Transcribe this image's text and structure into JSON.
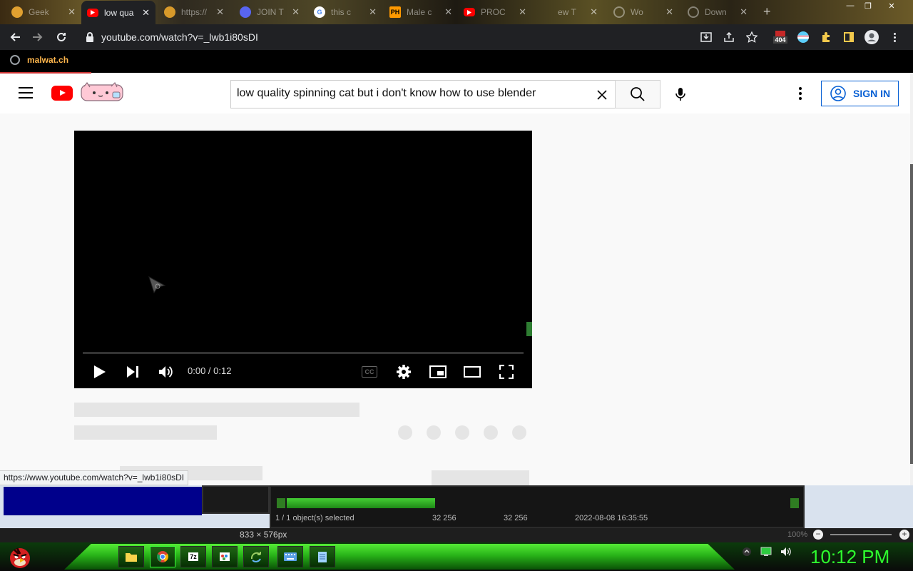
{
  "browser": {
    "tabs": [
      {
        "title": "Geek",
        "favicon": "orange-circle"
      },
      {
        "title": "low qua",
        "favicon": "youtube-icon",
        "active": true
      },
      {
        "title": "https://",
        "favicon": "orange-circle"
      },
      {
        "title": "JOIN T",
        "favicon": "discord-icon"
      },
      {
        "title": "this c",
        "favicon": "google-icon"
      },
      {
        "title": "Male c",
        "favicon": "ph-icon"
      },
      {
        "title": "PROC",
        "favicon": "youtube-icon"
      },
      {
        "title": "ew T",
        "favicon": "none"
      },
      {
        "title": "Wo",
        "favicon": "globe-icon"
      },
      {
        "title": "Down",
        "favicon": "globe-icon"
      }
    ],
    "ph_label": "PH",
    "new_tab_label": "+",
    "url": "youtube.com/watch?v=_lwb1i80sDI",
    "extension_badge": "404",
    "bookmark": "malwat.ch",
    "status_url": "https://www.youtube.com/watch?v=_lwb1i80sDI"
  },
  "youtube": {
    "search_value": "low quality spinning cat but i don't know how to use blender",
    "sign_in": "SIGN IN",
    "player": {
      "time": "0:00 / 0:12",
      "progress": 0,
      "cc_label": "CC"
    }
  },
  "background_app": {
    "selection": "1 / 1 object(s) selected",
    "val1": "32 256",
    "val2": "32 256",
    "timestamp": "2022-08-08 16:35:55",
    "dimensions": "833 × 576px",
    "zoom": "100%"
  },
  "taskbar": {
    "clock": "10:12 PM",
    "zip_label": "7z",
    "apps": [
      "folder-icon",
      "chrome-icon",
      "7zip-icon",
      "paint-icon",
      "recycle-icon",
      "keyboard-icon",
      "notepad-icon"
    ]
  },
  "colors": {
    "youtube_red": "#ff0000",
    "signin_blue": "#065fd4",
    "clock_green": "#2eff2e",
    "chrome_dark": "#202124"
  }
}
